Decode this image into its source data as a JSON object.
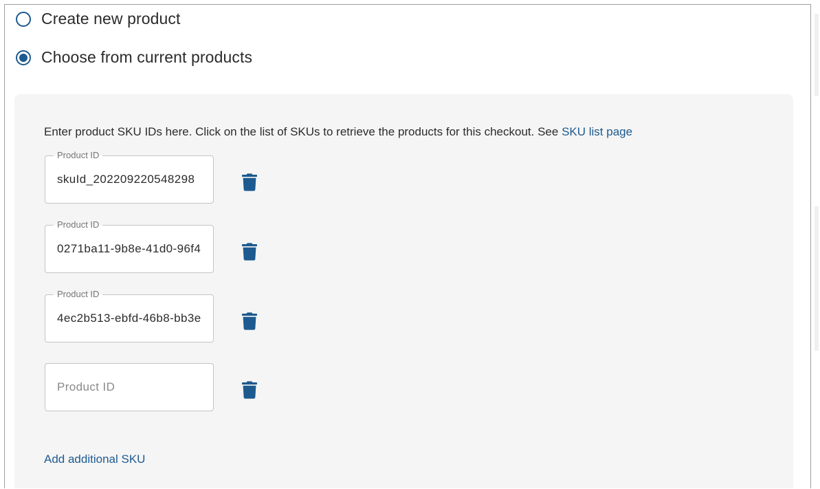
{
  "product_choice": {
    "options": [
      {
        "label": "Create new product",
        "selected": false
      },
      {
        "label": "Choose from current products",
        "selected": true
      }
    ]
  },
  "sku_panel": {
    "intro_text": "Enter product SKU IDs here. Click on the list of SKUs to retrieve the products for this checkout. See",
    "sku_list_link": "SKU list page",
    "fields": [
      {
        "label": "Product ID",
        "value": "skuId_202209220548298",
        "placeholder": "Product ID"
      },
      {
        "label": "Product ID",
        "value": "0271ba11-9b8e-41d0-96f4",
        "placeholder": "Product ID"
      },
      {
        "label": "Product ID",
        "value": "4ec2b513-ebfd-46b8-bb3e",
        "placeholder": "Product ID"
      },
      {
        "label": "",
        "value": "",
        "placeholder": "Product ID"
      }
    ],
    "delete_icon": "trash-icon",
    "add_link": "Add additional SKU"
  },
  "colors": {
    "accent": "#1d5a8f",
    "panel_bg": "#f5f5f5",
    "field_border": "#c4c4c4",
    "label_gray": "#757575"
  }
}
